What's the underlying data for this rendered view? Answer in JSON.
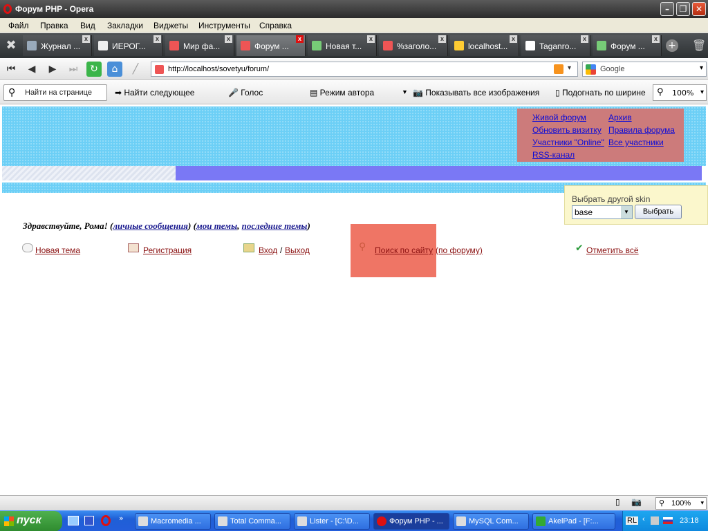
{
  "window": {
    "title": "Форум PHP - Opera"
  },
  "menu": [
    "Файл",
    "Правка",
    "Вид",
    "Закладки",
    "Виджеты",
    "Инструменты",
    "Справка"
  ],
  "tabs": [
    {
      "label": "Журнал ..."
    },
    {
      "label": "ИЕРОГ..."
    },
    {
      "label": "Мир фа..."
    },
    {
      "label": "Форум ..."
    },
    {
      "label": "Новая т..."
    },
    {
      "label": "%заголо..."
    },
    {
      "label": "localhost..."
    },
    {
      "label": "Taganro..."
    },
    {
      "label": "Форум ..."
    }
  ],
  "address": {
    "url": "http://localhost/sovetyu/forum/"
  },
  "search": {
    "engine": "Google"
  },
  "pagebar": {
    "find_placeholder": "Найти на странице",
    "find_next": "Найти следующее",
    "voice": "Голос",
    "author_mode": "Режим автора",
    "show_images": "Показывать все изображения",
    "fit_width": "Подогнать по ширине",
    "zoom": "100%"
  },
  "forum": {
    "links": {
      "live": "Живой форум",
      "archive": "Архив",
      "update_card": "Обновить визитку",
      "rules": "Правила форума",
      "online": "Участники \"Online\"",
      "all_members": "Все участники",
      "rss": "RSS-канал"
    },
    "skin": {
      "label": "Выбрать другой skin",
      "selected": "base",
      "button": "Выбрать"
    },
    "greeting": {
      "hello": "Здравствуйте, Рома!",
      "pm": "личные сообщения",
      "my_topics": "мои темы",
      "latest_topics": "последние темы"
    },
    "nav": {
      "new_topic": "Новая тема",
      "register": "Регистрация",
      "login": "Вход",
      "slash": "/",
      "logout": "Выход",
      "search_site": "Поиск по сайту",
      "search_forum": "(по форуму)",
      "mark_all": "Отметить всё"
    }
  },
  "status": {
    "zoom": "100%"
  },
  "taskbar": {
    "start": "пуск",
    "tasks": [
      {
        "label": "Macromedia ..."
      },
      {
        "label": "Total Comma..."
      },
      {
        "label": "Lister - [C:\\D..."
      },
      {
        "label": "Форум PHP - ..."
      },
      {
        "label": "MySQL Com..."
      },
      {
        "label": "AkelPad - [F:..."
      }
    ],
    "lang": "RL",
    "clock": "23:18"
  },
  "colors": {
    "header_band": "#6ccff6",
    "link_box": "#cc7b7b",
    "nav_stripe": "#7a78f5",
    "search_highlight": "#ef7565",
    "skin_box": "#fbf7cc"
  }
}
